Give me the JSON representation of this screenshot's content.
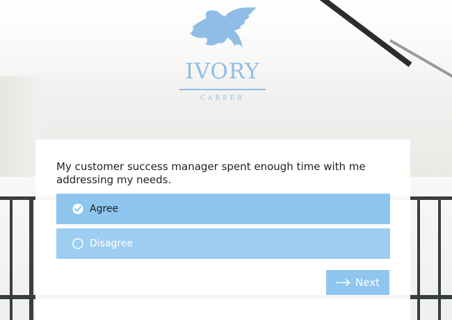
{
  "brand": {
    "name": "IVORY",
    "tagline": "CAREER",
    "logo_icon": "eagle-icon"
  },
  "survey": {
    "question": "My customer success manager spent enough time with me addressing my needs.",
    "options": [
      {
        "label": "Agree",
        "selected": true,
        "icon": "checked-circle-icon"
      },
      {
        "label": "Disagree",
        "selected": false,
        "icon": "empty-circle-icon"
      }
    ],
    "next_label": "Next",
    "next_icon": "dashed-arrow-right-icon"
  },
  "colors": {
    "accent": "#8fbde6",
    "option_selected": "#8fc6ef",
    "option_unselected": "#9dcdf1",
    "button": "#8fc6ef"
  }
}
